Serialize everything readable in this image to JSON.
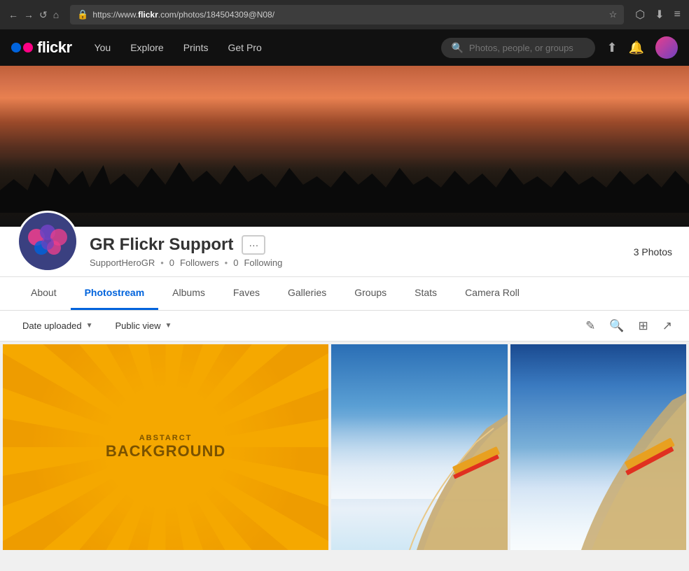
{
  "browser": {
    "url_prefix": "https://www.",
    "url_domain": "flickr",
    "url_suffix": ".com/photos/184504309@N08/",
    "full_url": "https://www.flickr.com/photos/184504309@N08/"
  },
  "nav": {
    "logo_text": "flickr",
    "links": {
      "you": "You",
      "explore": "Explore",
      "prints": "Prints",
      "get_pro": "Get Pro"
    },
    "search_placeholder": "Photos, people, or groups"
  },
  "profile": {
    "name": "GR Flickr Support",
    "username": "SupportHeroGR",
    "followers_count": "0",
    "followers_label": "Followers",
    "following_count": "0",
    "following_label": "Following",
    "photo_count": "3",
    "photo_count_label": "3 Photos"
  },
  "tabs": [
    {
      "id": "about",
      "label": "About"
    },
    {
      "id": "photostream",
      "label": "Photostream"
    },
    {
      "id": "albums",
      "label": "Albums"
    },
    {
      "id": "faves",
      "label": "Faves"
    },
    {
      "id": "galleries",
      "label": "Galleries"
    },
    {
      "id": "groups",
      "label": "Groups"
    },
    {
      "id": "stats",
      "label": "Stats"
    },
    {
      "id": "camera-roll",
      "label": "Camera Roll"
    }
  ],
  "toolbar": {
    "date_uploaded": "Date uploaded",
    "public_view": "Public view",
    "edit_icon": "✎",
    "search_icon": "🔍",
    "slideshow_icon": "⊡",
    "share_icon": "↗"
  },
  "photos": [
    {
      "id": "abstract",
      "sub_text": "ABSTARCT",
      "main_text": "BACKGROUND"
    },
    {
      "id": "plane1",
      "alt": "Airplane wing view from window"
    },
    {
      "id": "plane2",
      "alt": "Airplane wing view clouds below"
    }
  ]
}
